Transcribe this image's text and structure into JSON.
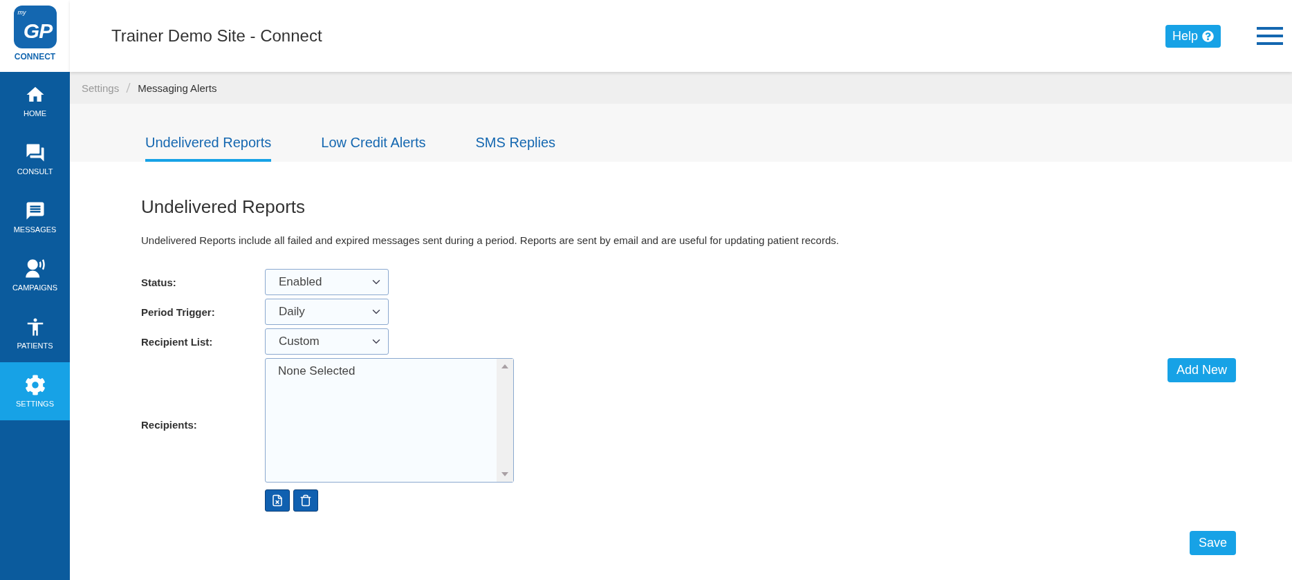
{
  "logo": {
    "superscript": "my",
    "mark": "GP",
    "caption": "CONNECT"
  },
  "header": {
    "title": "Trainer Demo Site - Connect",
    "help_button": "Help"
  },
  "sidebar": {
    "items": [
      {
        "kind": "home",
        "label": "HOME",
        "selected": false
      },
      {
        "kind": "consult",
        "label": "CONSULT",
        "selected": false
      },
      {
        "kind": "messages",
        "label": "MESSAGES",
        "selected": false
      },
      {
        "kind": "campaigns",
        "label": "CAMPAIGNS",
        "selected": false
      },
      {
        "kind": "patients",
        "label": "PATIENTS",
        "selected": false
      },
      {
        "kind": "settings",
        "label": "SETTINGS",
        "selected": true
      }
    ]
  },
  "breadcrumb": [
    "Settings",
    "Messaging Alerts"
  ],
  "tabs": [
    {
      "label": "Undelivered Reports",
      "selected": true
    },
    {
      "label": "Low Credit Alerts",
      "selected": false
    },
    {
      "label": "SMS Replies",
      "selected": false
    }
  ],
  "section": {
    "title": "Undelivered Reports",
    "description": "Undelivered Reports include all failed and expired messages sent during a period. Reports are sent by email and are useful for updating patient records."
  },
  "form": {
    "fields": [
      {
        "kind": "select",
        "label": "Status:",
        "value": "Enabled"
      },
      {
        "kind": "select",
        "label": "Period Trigger:",
        "value": "Daily"
      },
      {
        "kind": "select",
        "label": "Recipient List:",
        "value": "Custom"
      },
      {
        "kind": "list",
        "label": "Recipients:",
        "value": "None Selected"
      }
    ],
    "add_button": "Add New",
    "save_button": "Save"
  }
}
